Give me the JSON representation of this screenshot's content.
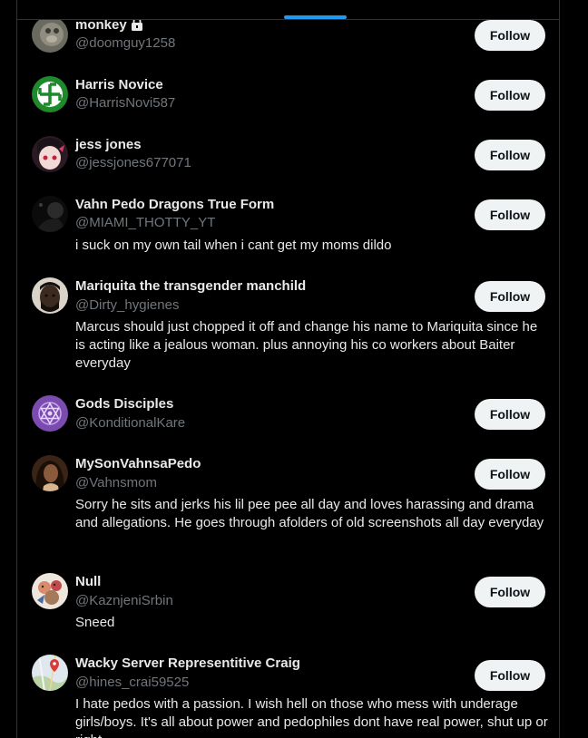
{
  "users": [
    {
      "name": "monkey",
      "handle": "@doomguy1258",
      "bio": "",
      "locked": true,
      "follow_label": "Follow"
    },
    {
      "name": "Harris Novice",
      "handle": "@HarrisNovi587",
      "bio": "",
      "follow_label": "Follow"
    },
    {
      "name": "jess jones",
      "handle": "@jessjones677071",
      "bio": "",
      "follow_label": "Follow"
    },
    {
      "name": "Vahn Pedo Dragons True Form",
      "handle": "@MIAMI_THOTTY_YT",
      "bio": "i suck on my own tail when i cant get my moms dildo",
      "follow_label": "Follow"
    },
    {
      "name": "Mariquita the transgender manchild",
      "handle": "@Dirty_hygienes",
      "bio": "Marcus should just chopped it off and change his name to Mariquita since he is acting like a jealous woman. plus annoying his co workers about Baiter everyday",
      "follow_label": "Follow"
    },
    {
      "name": "Gods Disciples",
      "handle": "@KonditionalKare",
      "bio": "",
      "follow_label": "Follow"
    },
    {
      "name": "MySonVahnsaPedo",
      "handle": "@Vahnsmom",
      "bio": "Sorry he sits and jerks his lil pee pee all day and loves harassing and drama and allegations. He goes through afolders of old screenshots all day everyday",
      "follow_label": "Follow"
    },
    {
      "name": "Null",
      "handle": "@KaznjeniSrbin",
      "bio": "Sneed",
      "follow_label": "Follow"
    },
    {
      "name": "Wacky Server Representitive Craig",
      "handle": "@hines_crai59525",
      "bio": "I hate pedos with a passion. I wish hell on those who mess with underage girls/boys. It's all about power and pedophiles dont have real power, shut up or right",
      "follow_label": "Follow"
    }
  ],
  "colors": {
    "background": "#000000",
    "text_primary": "#e7e9ea",
    "text_secondary": "#71767b",
    "accent": "#1d9bf0",
    "button_bg": "#eff3f4",
    "border": "#2f3336"
  },
  "icons": {
    "lock": "lock-icon",
    "avatar": "avatar"
  }
}
